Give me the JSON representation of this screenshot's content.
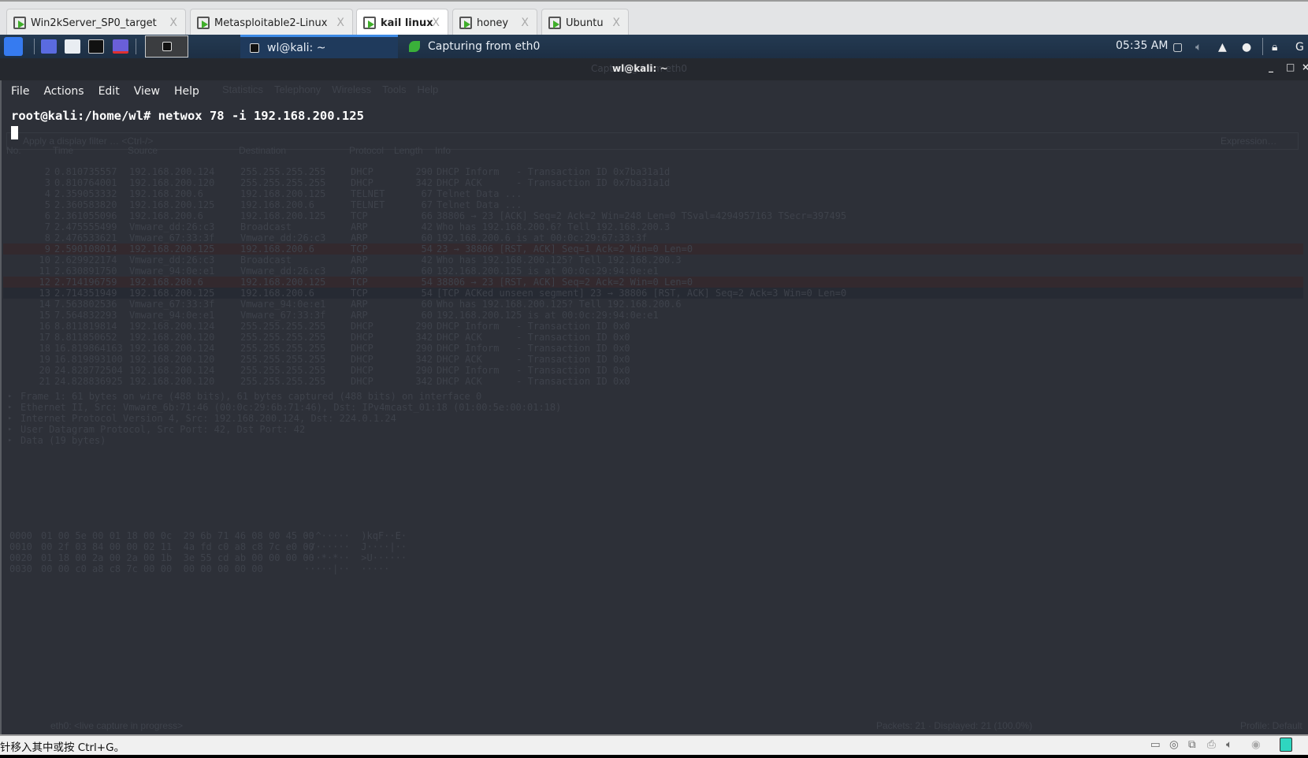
{
  "vm_tabs": [
    {
      "label": "Win2kServer_SP0_target",
      "active": false
    },
    {
      "label": "Metasploitable2-Linux",
      "active": false
    },
    {
      "label": "kail linux",
      "active": true
    },
    {
      "label": "honey",
      "active": false
    },
    {
      "label": "Ubuntu",
      "active": false
    }
  ],
  "tab_close": "X",
  "panel": {
    "tasks": [
      {
        "label": "wl@kali: ~",
        "icon": "terminal-icon"
      },
      {
        "label": "Capturing from eth0",
        "icon": "wireshark-icon"
      }
    ],
    "clock": "05:35 AM"
  },
  "window": {
    "title": "wl@kali: ~",
    "ghost_title": "Capturing from eth0",
    "controls": [
      "_",
      "□",
      "×"
    ]
  },
  "terminal": {
    "menu": [
      "File",
      "Actions",
      "Edit",
      "View",
      "Help"
    ],
    "prompt": "root@kali:/home/wl# netwox 78 -i 192.168.200.125"
  },
  "wireshark_ghost": {
    "menu": [
      "Statistics",
      "Telephony",
      "Wireless",
      "Tools",
      "Help"
    ],
    "filter_placeholder": "Apply a display filter … <Ctrl-/>",
    "expression": "Expression…",
    "columns": [
      "No.",
      "Time",
      "Source",
      "Destination",
      "Protocol",
      "Length",
      "Info"
    ],
    "packets": [
      [
        "2",
        "0.810735557",
        "192.168.200.124",
        "255.255.255.255",
        "DHCP",
        "290",
        "DHCP Inform   - Transaction ID 0x7ba31a1d",
        ""
      ],
      [
        "3",
        "0.810764001",
        "192.168.200.120",
        "255.255.255.255",
        "DHCP",
        "342",
        "DHCP ACK      - Transaction ID 0x7ba31a1d",
        ""
      ],
      [
        "4",
        "2.359053332",
        "192.168.200.6",
        "192.168.200.125",
        "TELNET",
        "67",
        "Telnet Data ...",
        ""
      ],
      [
        "5",
        "2.360583820",
        "192.168.200.125",
        "192.168.200.6",
        "TELNET",
        "67",
        "Telnet Data ...",
        ""
      ],
      [
        "6",
        "2.361055096",
        "192.168.200.6",
        "192.168.200.125",
        "TCP",
        "66",
        "38806 → 23 [ACK] Seq=2 Ack=2 Win=248 Len=0 TSval=4294957163 TSecr=397495",
        ""
      ],
      [
        "7",
        "2.475555499",
        "Vmware_dd:26:c3",
        "Broadcast",
        "ARP",
        "42",
        "Who has 192.168.200.6? Tell 192.168.200.3",
        ""
      ],
      [
        "8",
        "2.476533621",
        "Vmware_67:33:3f",
        "Vmware_dd:26:c3",
        "ARP",
        "60",
        "192.168.200.6 is at 00:0c:29:67:33:3f",
        ""
      ],
      [
        "9",
        "2.590108014",
        "192.168.200.125",
        "192.168.200.6",
        "TCP",
        "54",
        "23 → 38806 [RST, ACK] Seq=1 Ack=2 Win=0 Len=0",
        "red"
      ],
      [
        "10",
        "2.629922174",
        "Vmware_dd:26:c3",
        "Broadcast",
        "ARP",
        "42",
        "Who has 192.168.200.125? Tell 192.168.200.3",
        ""
      ],
      [
        "11",
        "2.630891750",
        "Vmware_94:0e:e1",
        "Vmware_dd:26:c3",
        "ARP",
        "60",
        "192.168.200.125 is at 00:0c:29:94:0e:e1",
        ""
      ],
      [
        "12",
        "2.714196759",
        "192.168.200.6",
        "192.168.200.125",
        "TCP",
        "54",
        "38806 → 23 [RST, ACK] Seq=2 Ack=2 Win=0 Len=0",
        "red"
      ],
      [
        "13",
        "2.714351949",
        "192.168.200.125",
        "192.168.200.6",
        "TCP",
        "54",
        "[TCP ACKed unseen segment] 23 → 38806 [RST, ACK] Seq=2 Ack=3 Win=0 Len=0",
        "sel"
      ],
      [
        "14",
        "7.563802536",
        "Vmware_67:33:3f",
        "Vmware_94:0e:e1",
        "ARP",
        "60",
        "Who has 192.168.200.125? Tell 192.168.200.6",
        ""
      ],
      [
        "15",
        "7.564832293",
        "Vmware_94:0e:e1",
        "Vmware_67:33:3f",
        "ARP",
        "60",
        "192.168.200.125 is at 00:0c:29:94:0e:e1",
        ""
      ],
      [
        "16",
        "8.811819814",
        "192.168.200.124",
        "255.255.255.255",
        "DHCP",
        "290",
        "DHCP Inform   - Transaction ID 0x0",
        ""
      ],
      [
        "17",
        "8.811850652",
        "192.168.200.120",
        "255.255.255.255",
        "DHCP",
        "342",
        "DHCP ACK      - Transaction ID 0x0",
        ""
      ],
      [
        "18",
        "16.819864163",
        "192.168.200.124",
        "255.255.255.255",
        "DHCP",
        "290",
        "DHCP Inform   - Transaction ID 0x0",
        ""
      ],
      [
        "19",
        "16.819893100",
        "192.168.200.120",
        "255.255.255.255",
        "DHCP",
        "342",
        "DHCP ACK      - Transaction ID 0x0",
        ""
      ],
      [
        "20",
        "24.828772504",
        "192.168.200.124",
        "255.255.255.255",
        "DHCP",
        "290",
        "DHCP Inform   - Transaction ID 0x0",
        ""
      ],
      [
        "21",
        "24.828836925",
        "192.168.200.120",
        "255.255.255.255",
        "DHCP",
        "342",
        "DHCP ACK      - Transaction ID 0x0",
        ""
      ]
    ],
    "details": [
      "Frame 1: 61 bytes on wire (488 bits), 61 bytes captured (488 bits) on interface 0",
      "Ethernet II, Src: Vmware_6b:71:46 (00:0c:29:6b:71:46), Dst: IPv4mcast_01:18 (01:00:5e:00:01:18)",
      "Internet Protocol Version 4, Src: 192.168.200.124, Dst: 224.0.1.24",
      "User Datagram Protocol, Src Port: 42, Dst Port: 42",
      "Data (19 bytes)"
    ],
    "hex": [
      [
        "0000",
        "01 00 5e 00 01 18 00 0c  29 6b 71 46 08 00 45 00",
        "··^·····  )kqF··E·"
      ],
      [
        "0010",
        "00 2f 03 84 00 00 02 11  4a fd c0 a8 c8 7c e0 00",
        "·/······  J····|··"
      ],
      [
        "0020",
        "01 18 00 2a 00 2a 00 1b  3e 55 cd ab 00 00 00 00",
        "···*·*··  >U······"
      ],
      [
        "0030",
        "00 00 c0 a8 c8 7c 00 00  00 00 00 00 00",
        "·····|··  ·····"
      ]
    ],
    "status_left": "eth0: <live capture in progress>",
    "status_mid": "Packets: 21 · Displayed: 21 (100.0%)",
    "status_right": "Profile: Default"
  },
  "vbox_status": {
    "hint": "针移入其中或按 Ctrl+G。"
  }
}
